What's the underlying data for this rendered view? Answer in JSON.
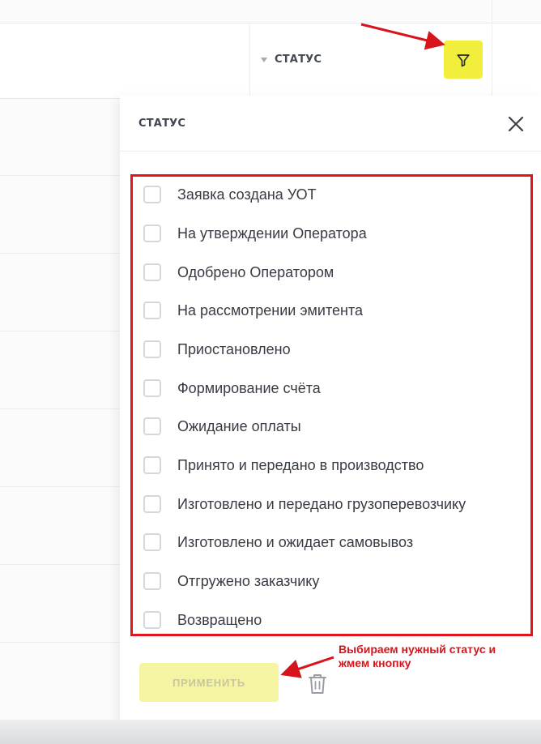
{
  "table": {
    "column_header": "СТАТУС",
    "filter_icon": "filter-icon"
  },
  "filter_panel": {
    "title": "СТАТУС",
    "close_icon": "close-icon",
    "options": [
      {
        "label": "Заявка создана УОТ",
        "checked": false
      },
      {
        "label": "На утверждении Оператора",
        "checked": false
      },
      {
        "label": "Одобрено Оператором",
        "checked": false
      },
      {
        "label": "На рассмотрении эмитента",
        "checked": false
      },
      {
        "label": "Приостановлено",
        "checked": false
      },
      {
        "label": "Формирование счёта",
        "checked": false
      },
      {
        "label": "Ожидание оплаты",
        "checked": false
      },
      {
        "label": "Принято и передано в производство",
        "checked": false
      },
      {
        "label": "Изготовлено и передано грузоперевозчику",
        "checked": false
      },
      {
        "label": "Изготовлено и ожидает самовывоз",
        "checked": false
      },
      {
        "label": "Отгружено заказчику",
        "checked": false
      },
      {
        "label": "Возвращено",
        "checked": false
      }
    ],
    "apply_label": "ПРИМЕНИТЬ",
    "trash_icon": "trash-icon"
  },
  "annotation": {
    "line1": "Выбираем нужный статус и",
    "line2": "жмем кнопку",
    "color": "#d7141b"
  },
  "colors": {
    "accent_yellow": "#f1ef3b",
    "apply_disabled": "#f5f4a2",
    "highlight_red": "#e4141c"
  }
}
